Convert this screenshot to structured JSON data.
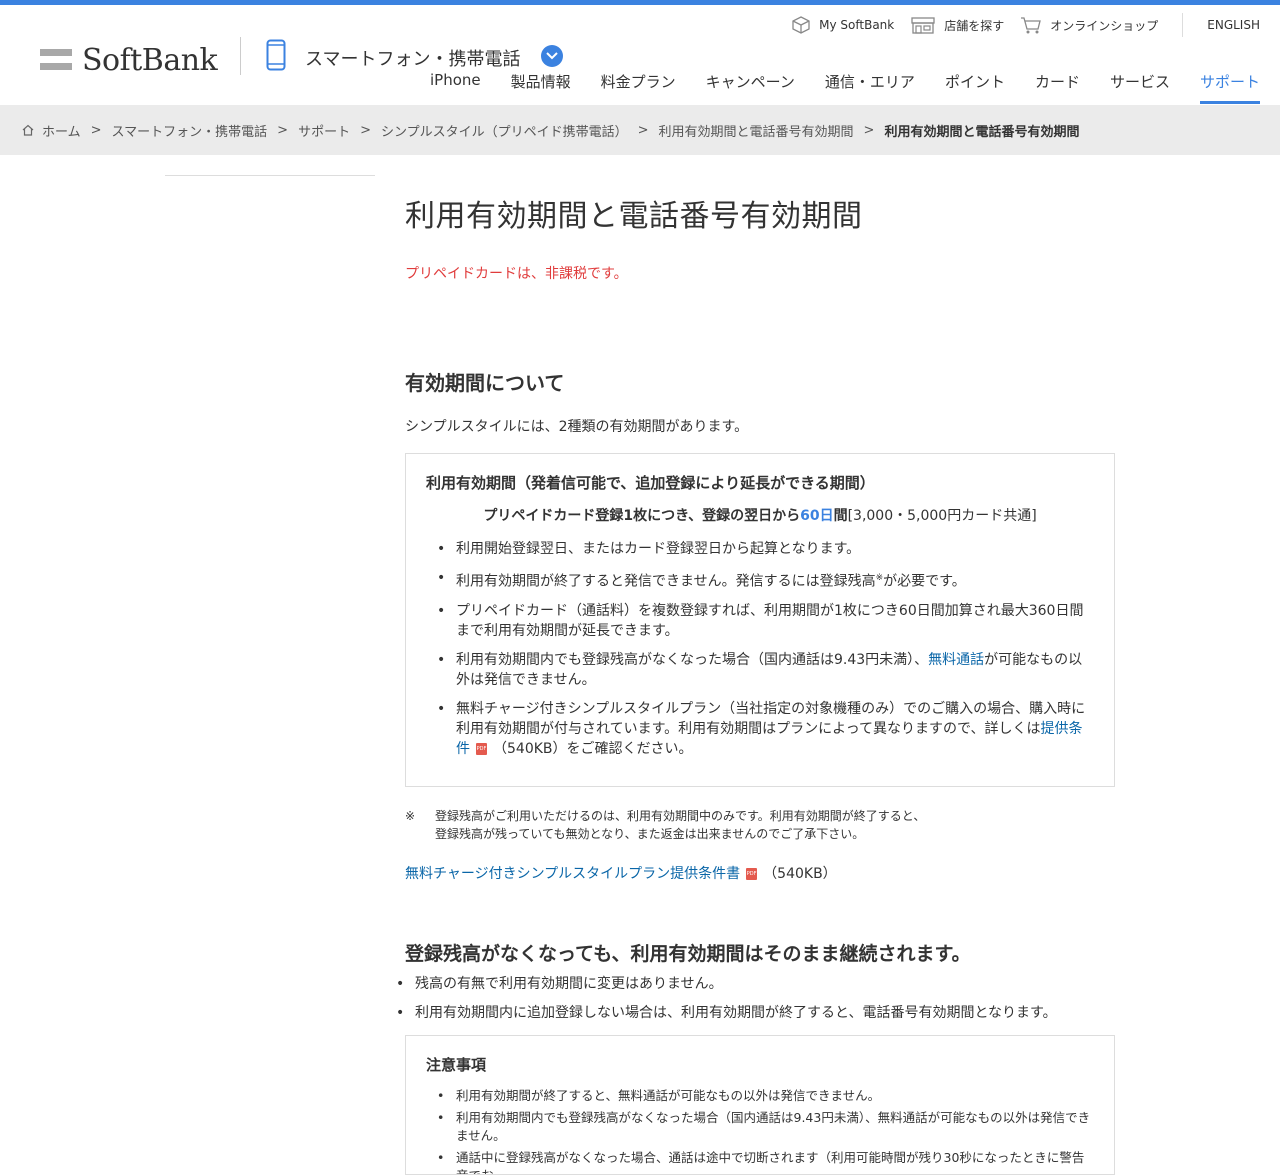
{
  "colors": {
    "accent": "#3b82e0",
    "warning_text": "#e03c3c",
    "link": "#0a66a8"
  },
  "brand": {
    "logo_text": "SoftBank"
  },
  "header": {
    "category_title": "スマートフォン・携帯電話",
    "utility": [
      {
        "label": "My SoftBank",
        "icon": "cube-icon"
      },
      {
        "label": "店舗を探す",
        "icon": "store-icon"
      },
      {
        "label": "オンラインショップ",
        "icon": "cart-icon"
      }
    ],
    "language": "ENGLISH",
    "nav": [
      "iPhone",
      "製品情報",
      "料金プラン",
      "キャンペーン",
      "通信・エリア",
      "ポイント",
      "カード",
      "サービス",
      "サポート"
    ],
    "nav_active": "サポート"
  },
  "breadcrumb": {
    "items": [
      "ホーム",
      "スマートフォン・携帯電話",
      "サポート",
      "シンプルスタイル（プリペイド携帯電話）",
      "利用有効期間と電話番号有効期間"
    ],
    "separator": ">",
    "current": "利用有効期間と電話番号有効期間"
  },
  "main": {
    "title": "利用有効期間と電話番号有効期間",
    "tax_note": "プリペイドカードは、非課税です。",
    "section1": {
      "heading": "有効期間について",
      "intro": "シンプルスタイルには、2種類の有効期間があります。",
      "box": {
        "title": "利用有効期間（発着信可能で、追加登録により延長ができる期間）",
        "center_prefix": "プリペイドカード登録1枚につき、登録の翌日から",
        "center_days": "60日",
        "center_suffix_bold": "間",
        "center_suffix": "[3,000・5,000円カード共通]",
        "bullets": {
          "b1": "利用開始登録翌日、またはカード登録翌日から起算となります。",
          "b2_before": "利用有効期間が終了すると発信できません。発信するには登録残高",
          "b2_sup": "※",
          "b2_after": "が必要です。",
          "b3": "プリペイドカード（通話料）を複数登録すれば、利用期間が1枚につき60日間加算され最大360日間まで利用有効期間が延長できます。",
          "b4_before": "利用有効期間内でも登録残高がなくなった場合（国内通話は9.43円未満）、",
          "b4_link": "無料通話",
          "b4_after": "が可能なもの以外は発信できません。",
          "b5_before": "無料チャージ付きシンプルスタイルプラン（当社指定の対象機種のみ）でのご購入の場合、購入時に利用有効期間が付与されています。利用有効期間はプランによって異なりますので、詳しくは",
          "b5_link": "提供条件",
          "b5_size": "（540KB）",
          "b5_after": "をご確認ください。"
        }
      },
      "footnote_mark": "※",
      "footnote_line1": "登録残高がご利用いただけるのは、利用有効期間中のみです。利用有効期間が終了すると、",
      "footnote_line2": "登録残高が残っていても無効となり、また返金は出来ませんのでご了承下さい。",
      "doc_link": "無料チャージ付きシンプルスタイルプラン提供条件書",
      "doc_size": "（540KB）",
      "pdf_label": "PDF"
    },
    "section2": {
      "heading": "登録残高がなくなっても、利用有効期間はそのまま継続されます。",
      "bullets": [
        "残高の有無で利用有効期間に変更はありません。",
        "利用有効期間内に追加登録しない場合は、利用有効期間が終了すると、電話番号有効期間となります。"
      ],
      "notes_box": {
        "title": "注意事項",
        "bullets": [
          "利用有効期間が終了すると、無料通話が可能なもの以外は発信できません。",
          "利用有効期間内でも登録残高がなくなった場合（国内通話は9.43円未満）、無料通話が可能なもの以外は発信できません。",
          "通話中に登録残高がなくなった場合、通話は途中で切断されます（利用可能時間が残り30秒になったときに警告音でお"
        ]
      }
    }
  }
}
